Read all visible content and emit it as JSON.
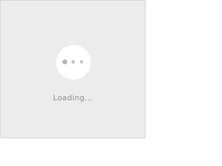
{
  "loader": {
    "text": "Loading..."
  },
  "icons": {
    "spinner": "loading-dots-icon"
  },
  "colors": {
    "background": "#ececec",
    "circle": "#ffffff",
    "dot": "#b6b6b6",
    "text": "#8c8c8c"
  }
}
